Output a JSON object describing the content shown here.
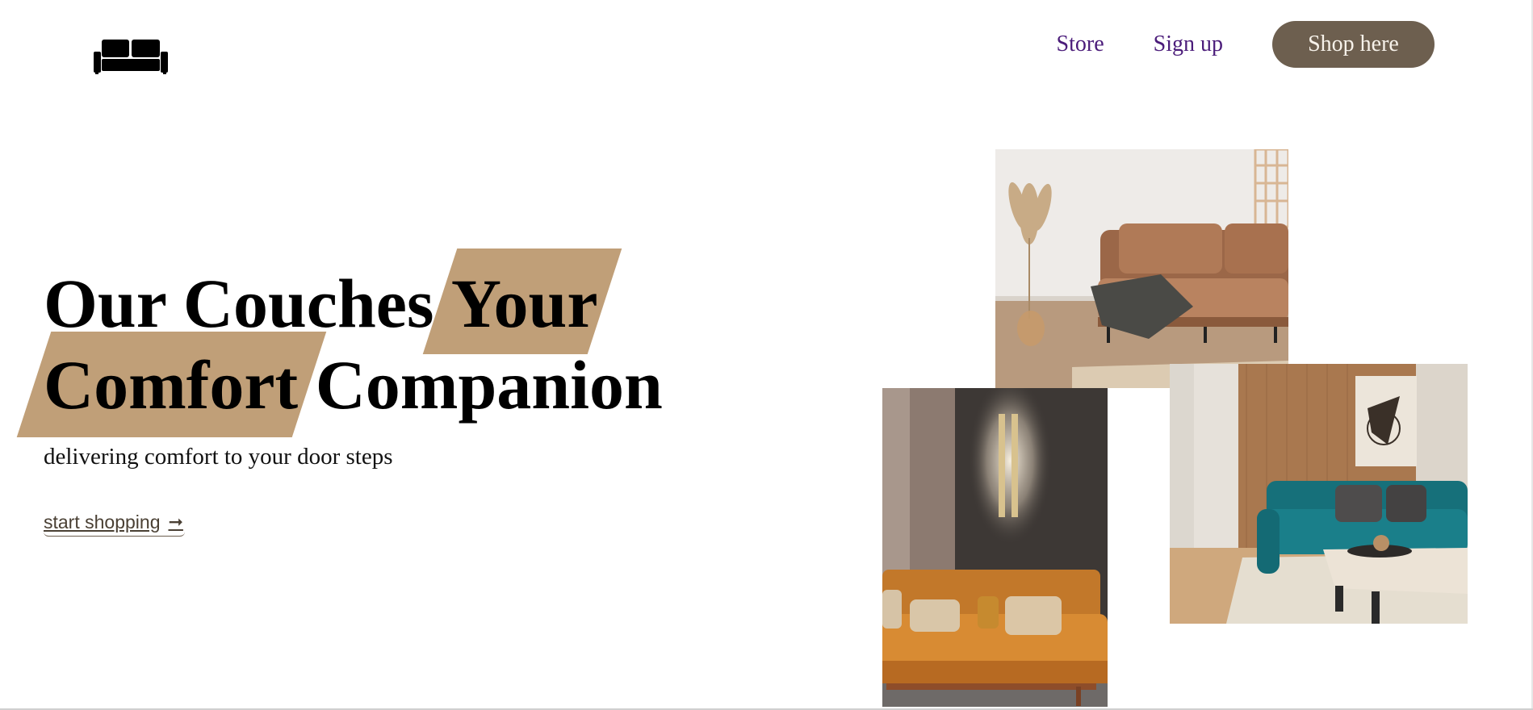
{
  "header": {
    "logo_icon": "sofa-icon",
    "nav": {
      "store_label": "Store",
      "signup_label": "Sign up",
      "shop_label": "Shop here"
    },
    "colors": {
      "nav_link": "#4b1c7a",
      "shop_button_bg": "#6d5f4f",
      "shop_button_text": "#f7f2ea"
    }
  },
  "hero": {
    "title_part1": "Our Couches ",
    "title_highlight1": "Your",
    "title_highlight2": "Comfort",
    "title_part2": " Companion",
    "subtitle": "delivering comfort to your door steps",
    "cta_label": "start shopping",
    "cta_icon": "arrow-right-icon",
    "highlight_color": "#c09f78"
  },
  "gallery": {
    "images": [
      "photo-brown-leather-sofa",
      "photo-orange-leather-sofa",
      "photo-teal-velvet-sofa"
    ]
  }
}
